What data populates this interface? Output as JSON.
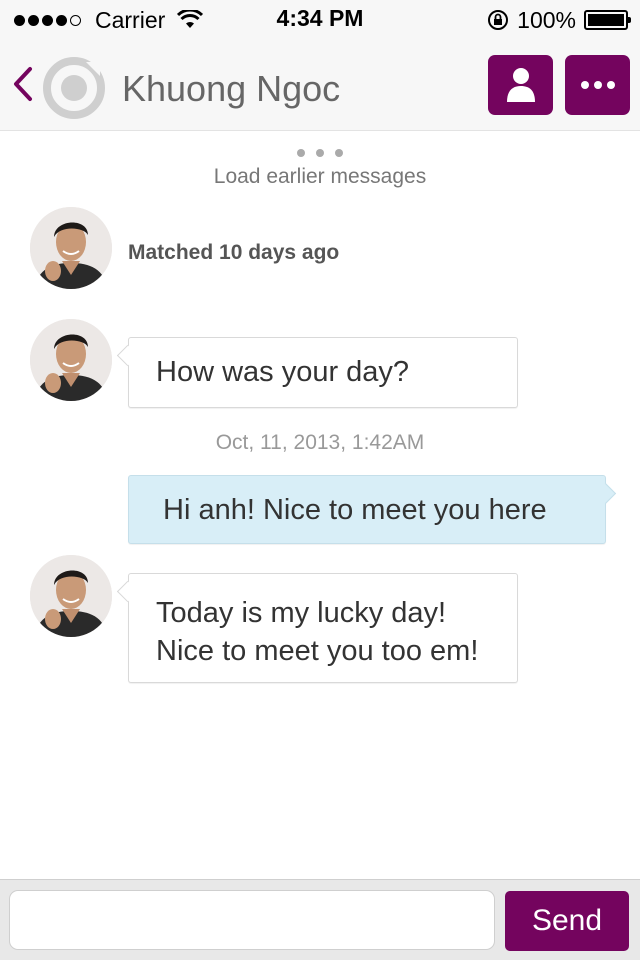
{
  "status_bar": {
    "carrier": "Carrier",
    "time": "4:34 PM",
    "battery_percent": "100%",
    "signal_bars_filled": 4,
    "signal_bars_total": 5
  },
  "nav": {
    "title": "Khuong Ngoc",
    "back_icon": "chevron-left-icon",
    "logo_icon": "app-logo-icon",
    "profile_icon": "person-icon",
    "more_icon": "ellipsis-icon",
    "accent_color": "#74045e"
  },
  "chat": {
    "load_earlier": "Load earlier messages",
    "matched_text": "Matched 10 days ago",
    "messages": [
      {
        "direction": "incoming",
        "lines": [
          "How was your day?"
        ]
      },
      {
        "timestamp": "Oct, 11, 2013, 1:42AM"
      },
      {
        "direction": "outgoing",
        "lines": [
          "Hi anh! Nice to meet you here"
        ]
      },
      {
        "direction": "incoming",
        "lines": [
          "Today is my lucky day!",
          "Nice to meet you too em!"
        ]
      }
    ]
  },
  "composer": {
    "input_value": "",
    "input_placeholder": "",
    "send_label": "Send"
  }
}
